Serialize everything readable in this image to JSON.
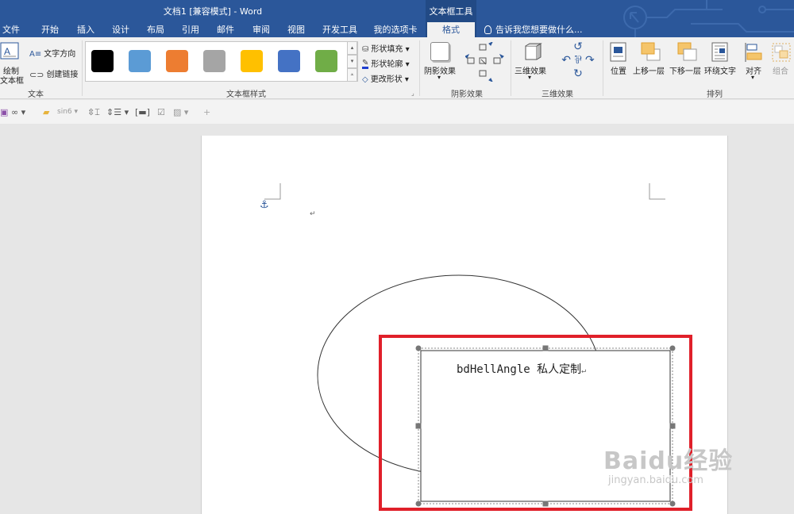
{
  "window": {
    "title": "文档1 [兼容模式] - Word",
    "context_group": "文本框工具"
  },
  "tabs": [
    {
      "label": "文件"
    },
    {
      "label": "开始"
    },
    {
      "label": "插入"
    },
    {
      "label": "设计"
    },
    {
      "label": "布局"
    },
    {
      "label": "引用"
    },
    {
      "label": "邮件"
    },
    {
      "label": "审阅"
    },
    {
      "label": "视图"
    },
    {
      "label": "开发工具"
    },
    {
      "label": "我的选项卡"
    },
    {
      "label": "格式",
      "active": true
    }
  ],
  "tell_me": "告诉我您想要做什么...",
  "ribbon": {
    "text_group": {
      "label": "文本",
      "draw_textbox_line1": "绘制",
      "draw_textbox_line2": "文本框",
      "text_direction": "文字方向",
      "create_link": "创建链接"
    },
    "textbox_styles": {
      "label": "文本框样式",
      "swatches": [
        "#000000",
        "#5b9bd5",
        "#ed7d31",
        "#a5a5a5",
        "#ffc000",
        "#4472c4",
        "#70ad47"
      ],
      "shape_fill": "形状填充",
      "shape_outline": "形状轮廓",
      "change_shape": "更改形状"
    },
    "shadow": {
      "label": "阴影效果",
      "button": "阴影效果"
    },
    "threed": {
      "label": "三维效果",
      "button": "三维效果"
    },
    "arrange": {
      "label": "排列",
      "position": "位置",
      "bring_forward": "上移一层",
      "send_backward": "下移一层",
      "wrap_text": "环绕文字",
      "align": "对齐",
      "group": "组合"
    }
  },
  "quickbar": {
    "sign": "sin6"
  },
  "document": {
    "textbox_text": "bdHellAngle 私人定制",
    "paragraph_mark": "↵"
  },
  "watermark": {
    "logo": "Baidu经验",
    "url": "jingyan.baidu.com"
  },
  "colors": {
    "title_blue": "#2b579a",
    "highlight_red": "#e0202a"
  }
}
